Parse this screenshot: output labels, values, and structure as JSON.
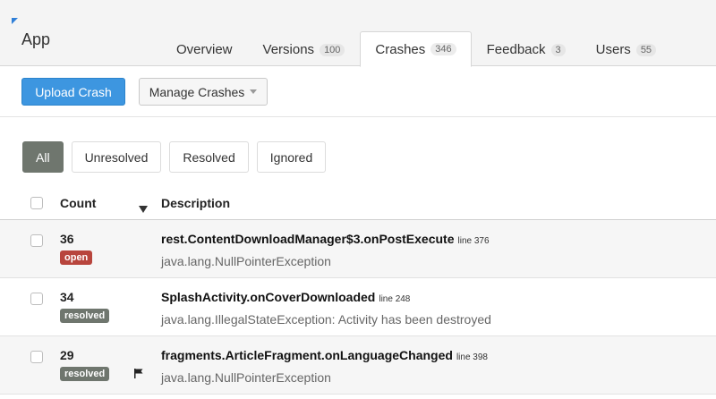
{
  "app": {
    "title": "App",
    "accent": "#3d96e0"
  },
  "tabs": [
    {
      "label": "Overview",
      "count": ""
    },
    {
      "label": "Versions",
      "count": "100"
    },
    {
      "label": "Crashes",
      "count": "346",
      "active": true
    },
    {
      "label": "Feedback",
      "count": "3"
    },
    {
      "label": "Users",
      "count": "55"
    }
  ],
  "toolbar": {
    "upload_label": "Upload Crash",
    "manage_label": "Manage Crashes"
  },
  "filters": [
    {
      "label": "All",
      "active": true
    },
    {
      "label": "Unresolved"
    },
    {
      "label": "Resolved"
    },
    {
      "label": "Ignored"
    }
  ],
  "table": {
    "headers": {
      "count": "Count",
      "description": "Description"
    },
    "rows": [
      {
        "count": "36",
        "status": "open",
        "title": "rest.ContentDownloadManager$3.onPostExecute",
        "line": "line 376",
        "exception": "java.lang.NullPointerException",
        "flag": false
      },
      {
        "count": "34",
        "status": "resolved",
        "title": "SplashActivity.onCoverDownloaded",
        "line": "line 248",
        "exception": "java.lang.IllegalStateException: Activity has been destroyed",
        "flag": false
      },
      {
        "count": "29",
        "status": "resolved",
        "title": "fragments.ArticleFragment.onLanguageChanged",
        "line": "line 398",
        "exception": "java.lang.NullPointerException",
        "flag": true
      }
    ]
  },
  "colors": {
    "open": "#b8453d",
    "resolved": "#6f766e",
    "primary": "#3d96e0"
  },
  "icons": {
    "sort": "caret-down-icon",
    "flag": "flag-icon",
    "dropdown": "caret-icon"
  }
}
